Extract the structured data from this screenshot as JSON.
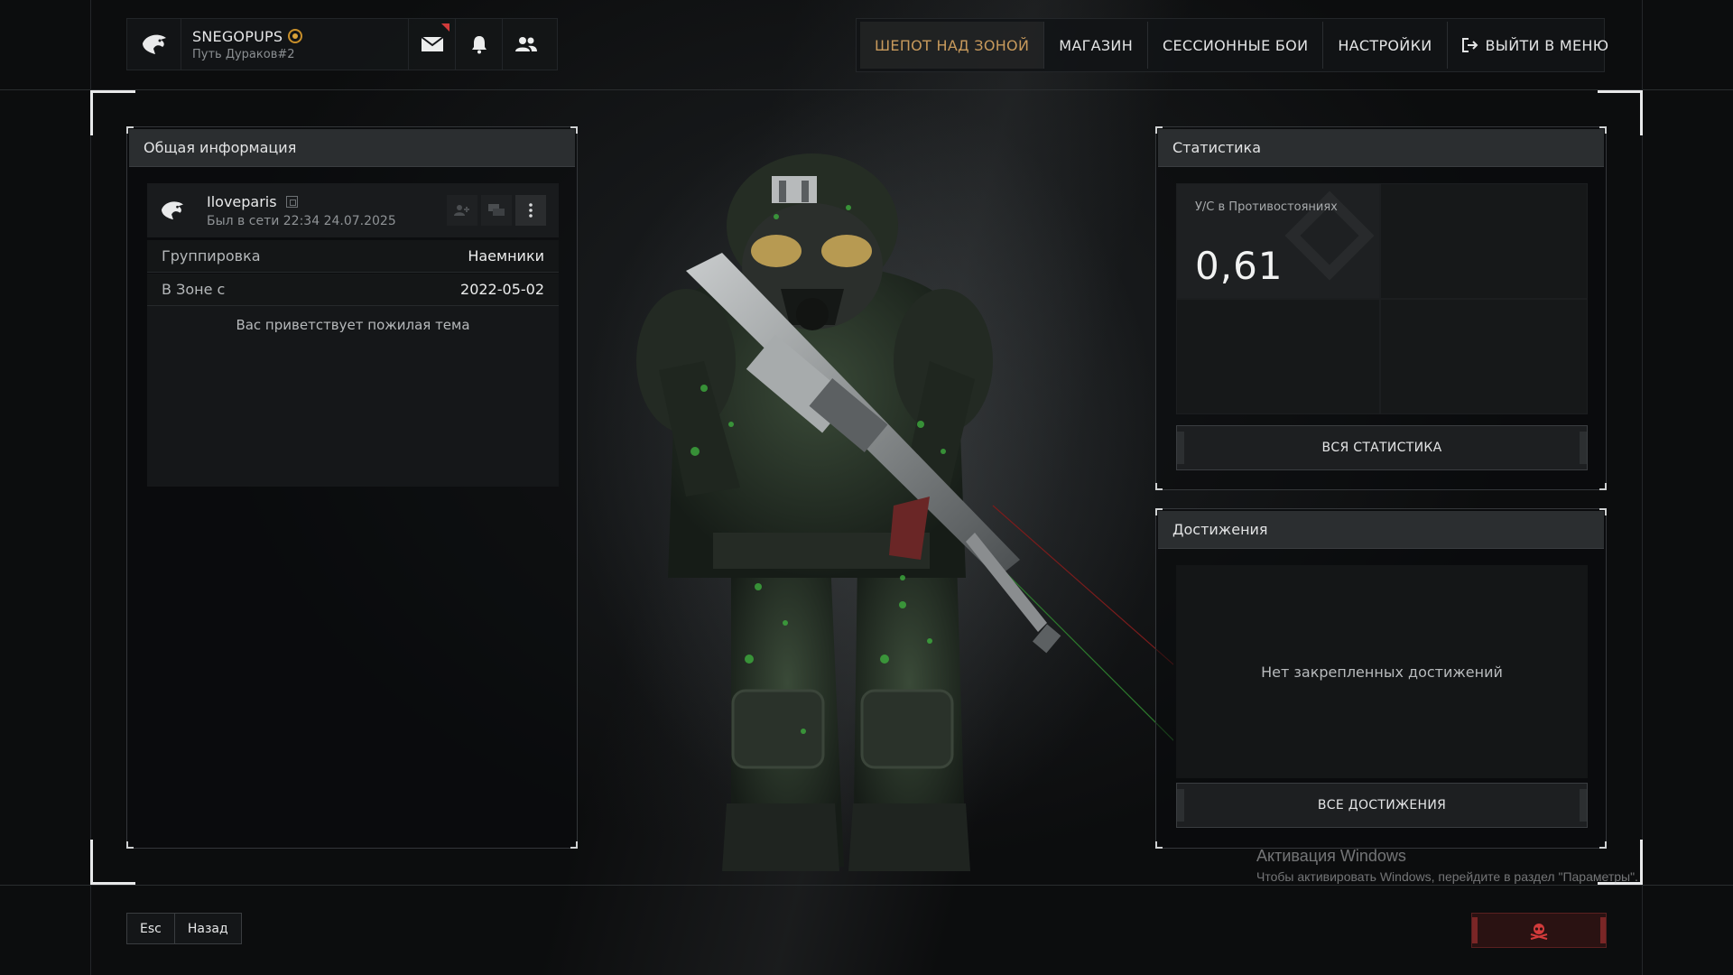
{
  "profile": {
    "player_name": "SNEGOPUPS",
    "clan": "Путь Дураков#2",
    "icons": [
      "eagle-emblem-icon",
      "mail-icon",
      "bell-icon",
      "friends-icon"
    ]
  },
  "nav": {
    "items": [
      {
        "label": "ШЕПОТ НАД ЗОНОЙ",
        "active": true
      },
      {
        "label": "МАГАЗИН",
        "active": false
      },
      {
        "label": "СЕССИОННЫЕ БОИ",
        "active": false
      },
      {
        "label": "НАСТРОЙКИ",
        "active": false
      },
      {
        "label": "ВЫЙТИ В МЕНЮ",
        "active": false
      }
    ]
  },
  "general": {
    "title": "Общая информация",
    "username": "Iloveparis",
    "last_seen": "Был в сети 22:34 24.07.2025",
    "rows": [
      {
        "key": "Группировка",
        "value": "Наемники"
      },
      {
        "key": "В Зоне с",
        "value": "2022-05-02"
      }
    ],
    "about": "Вас приветствует пожилая тема"
  },
  "stats": {
    "title": "Статистика",
    "kd_label": "У/С в Противостояниях",
    "kd_value": "0,61",
    "all_button": "ВСЯ СТАТИСТИКА"
  },
  "achievements": {
    "title": "Достижения",
    "empty_text": "Нет закрепленных достижений",
    "all_button": "ВСЕ ДОСТИЖЕНИЯ"
  },
  "footer": {
    "esc_label": "Esc",
    "back_label": "Назад"
  },
  "watermark": {
    "title": "Активация Windows",
    "subtitle": "Чтобы активировать Windows, перейдите в раздел \"Параметры\"."
  },
  "colors": {
    "accent_active": "#c89a5c",
    "report_red": "#d23b3b"
  }
}
